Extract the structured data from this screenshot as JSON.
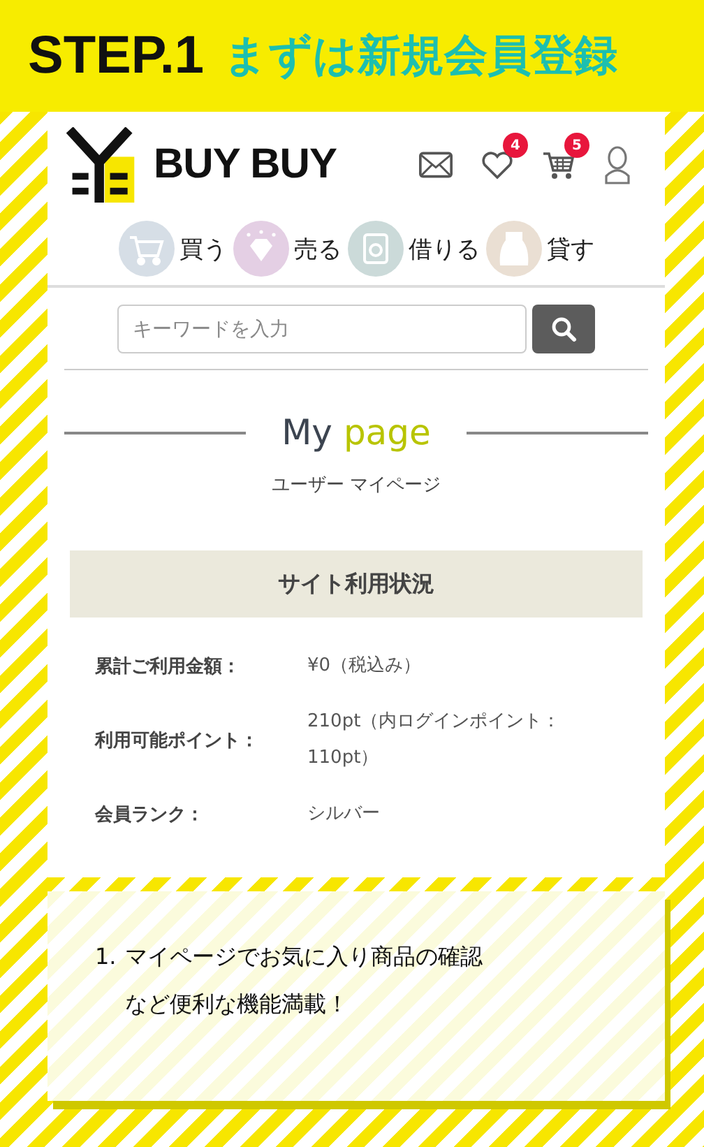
{
  "banner": {
    "step": "STEP.1",
    "title": "まずは新規会員登録"
  },
  "site": {
    "logo_text": "BUY BUY",
    "header_icons": [
      {
        "kind": "mail"
      },
      {
        "kind": "heart",
        "badge": "4"
      },
      {
        "kind": "cart",
        "badge": "5"
      },
      {
        "kind": "user"
      }
    ],
    "categories": [
      {
        "kind": "cart",
        "label": "買う",
        "color": "#d6dee6"
      },
      {
        "kind": "diamond",
        "label": "売る",
        "color": "#e4cfe4"
      },
      {
        "kind": "ring",
        "label": "借りる",
        "color": "#cbdad9"
      },
      {
        "kind": "necklace",
        "label": "貸す",
        "color": "#eadfd3"
      }
    ],
    "search": {
      "placeholder": "キーワードを入力"
    },
    "heading": {
      "first": "My",
      "second": "page",
      "subtitle": "ユーザー マイページ"
    },
    "section_title": "サイト利用状況",
    "stats": [
      {
        "label": "累計ご利用金額：",
        "value_lines": [
          "¥0（税込み）"
        ]
      },
      {
        "label": "利用可能ポイント：",
        "value_lines": [
          "210pt（内ログインポイント：",
          "110pt）"
        ]
      },
      {
        "label": "会員ランク：",
        "value_lines": [
          "シルバー"
        ]
      }
    ]
  },
  "note": {
    "number": "1.",
    "lines": [
      "マイページでお気に入り商品の確認",
      "など便利な機能満載！"
    ]
  }
}
